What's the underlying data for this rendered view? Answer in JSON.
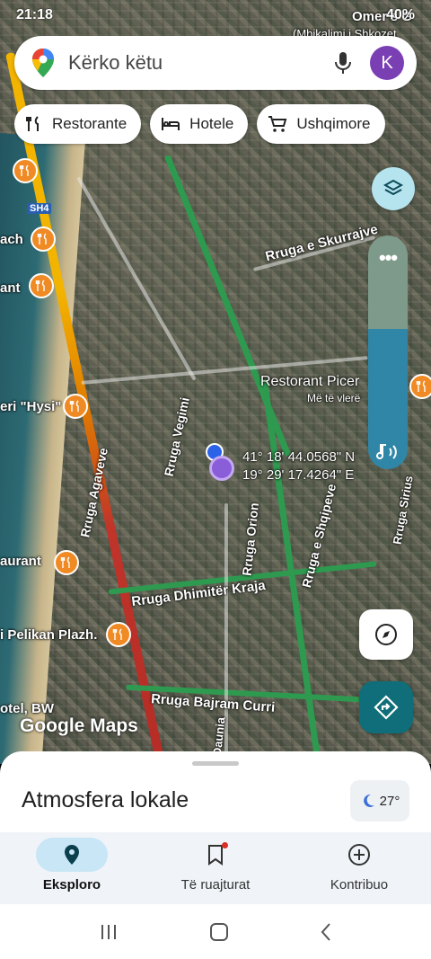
{
  "status_bar": {
    "time": "21:18",
    "battery": "40%"
  },
  "search": {
    "placeholder": "Kërko këtu",
    "avatar_initial": "K"
  },
  "chips": [
    {
      "label": "Restorante",
      "icon": "fork-knife-icon"
    },
    {
      "label": "Hotele",
      "icon": "bed-icon"
    },
    {
      "label": "Ushqimore",
      "icon": "cart-icon"
    }
  ],
  "map": {
    "labels": {
      "skurraj": "Rruga e Skurrajve",
      "restorant_picer": "Restorant Picer",
      "restorant_sub": "Më të vlerë",
      "vegimi": "Rruga Vegimi",
      "agavet": "Rruga Agaveve",
      "orion": "Rruga Orion",
      "shqipe": "Rruga e Shqipeve",
      "sirius": "Rruga Sirius",
      "dhimiter": "Rruga Dhimitër Kraja",
      "bajram": "Rruga Bajram Curri",
      "daunia": "Daunia",
      "hysi": "eri \"Hysi\"",
      "aurant": "aurant",
      "pelikan": "i Pelikan Plazh.",
      "bw": "otel, BW",
      "ach": "ach",
      "ant": "ant",
      "sh4": "SH4",
      "omers": "Omer's G",
      "shkozet": "(Mbikalimi i Shkozet"
    },
    "coords": {
      "lat": "41° 18' 44.0568\" N",
      "lon": "19° 29' 17.4264\" E"
    },
    "logo": "Google Maps"
  },
  "sheet": {
    "title": "Atmosfera lokale",
    "weather": "27°"
  },
  "bottom_nav": [
    {
      "label": "Eksploro",
      "active": true
    },
    {
      "label": "Të ruajturat",
      "active": false
    },
    {
      "label": "Kontribuo",
      "active": false
    }
  ],
  "colors": {
    "accent": "#0f6e79",
    "food_pin": "#f08a24",
    "avatar": "#7b3fb4"
  }
}
